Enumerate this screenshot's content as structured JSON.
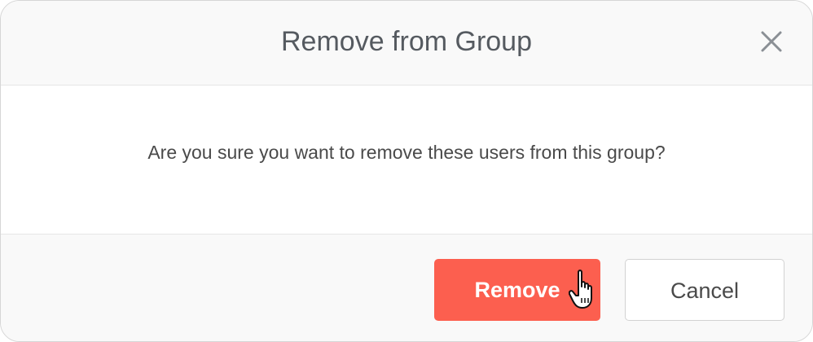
{
  "dialog": {
    "title": "Remove from Group",
    "close_icon": "close-icon",
    "message": "Are you sure you want to remove these users from this group?",
    "buttons": {
      "remove_label": "Remove",
      "cancel_label": "Cancel"
    }
  },
  "colors": {
    "remove_button": "#fc5f4f",
    "header_background": "#f9f9f9",
    "text": "#4a4a4a"
  },
  "cursor_icon": "hand-pointer-icon"
}
